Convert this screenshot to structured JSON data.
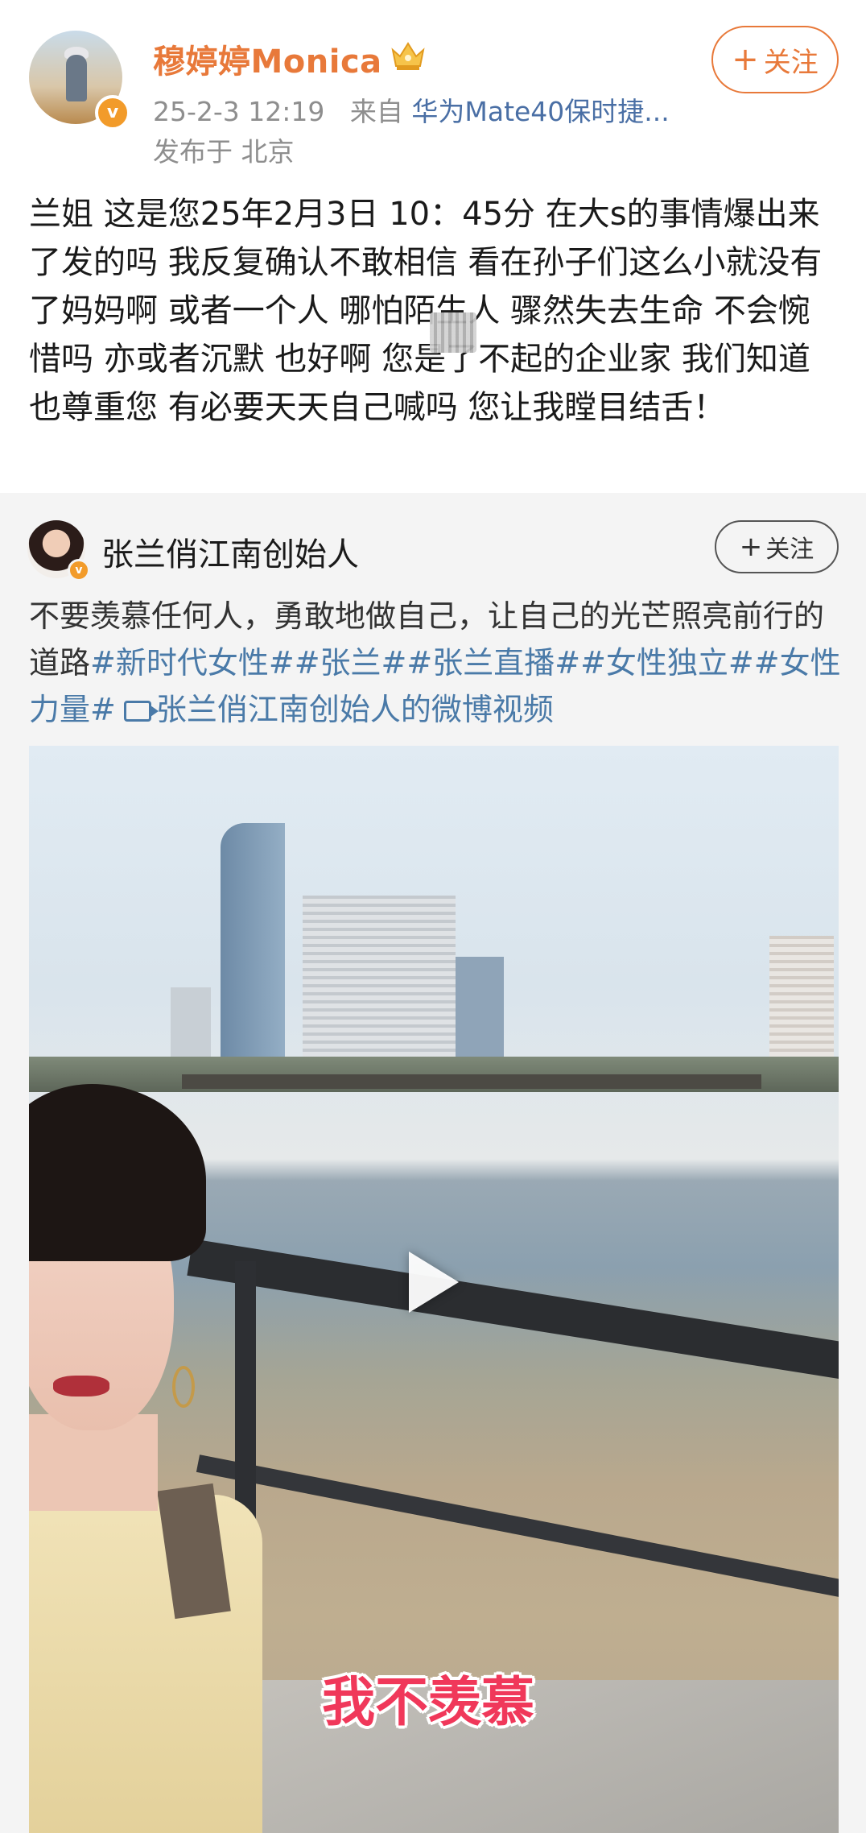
{
  "post": {
    "author_name": "穆婷婷Monica",
    "verified_badge_glyph": "v",
    "timestamp": "25-2-3 12:19",
    "source_prefix": "来自",
    "source_device": "华为Mate40保时捷...",
    "location": "发布于 北京",
    "follow_label": "关注",
    "text": "兰姐 这是您25年2月3日 10：45分 在大s的事情爆出来了发的吗 我反复确认不敢相信 看在孙子们这么小就没有了妈妈啊 或者一个人 哪怕陌生人 骤然失去生命 不会惋惜吗 亦或者沉默 也好啊 您是了不起的企业家 我们知道 也尊重您 有必要天天自己喊吗 您让我瞠目结舌！",
    "accent_color": "#e8793a"
  },
  "repost": {
    "author_name": "张兰俏江南创始人",
    "follow_label": "关注",
    "text_plain": "不要羡慕任何人，勇敢地做自己，让自己的光芒照亮前行的道路",
    "tags": [
      "#新时代女性#",
      "#张兰#",
      "#张兰直播#",
      "#女性独立#",
      "#女性力量#"
    ],
    "video_link": "张兰俏江南创始人的微博视频",
    "link_color": "#4a7aa8"
  },
  "video": {
    "subtitle": "我不羡慕",
    "play_icon": "play-icon"
  }
}
